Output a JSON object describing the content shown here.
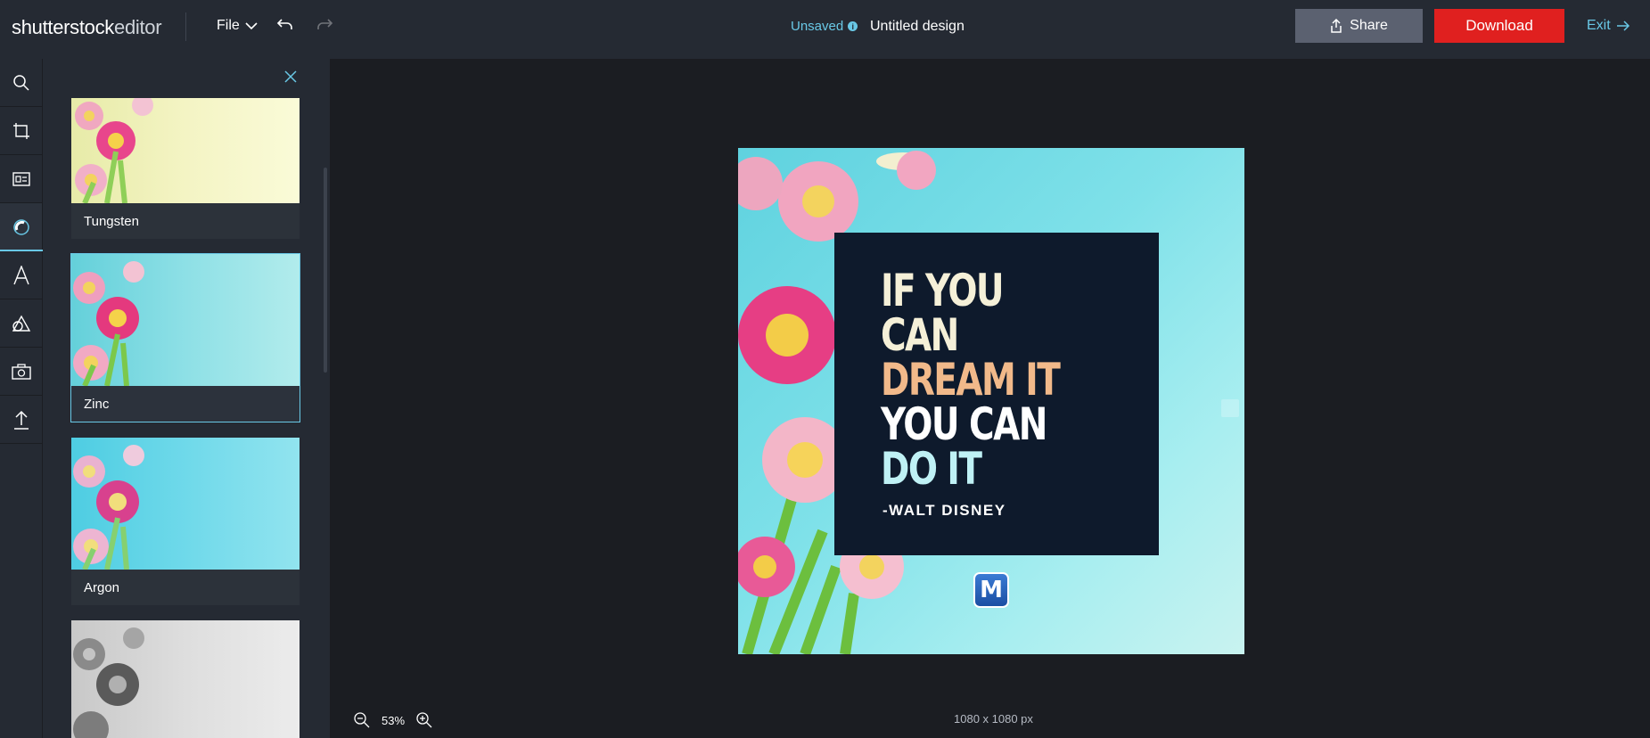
{
  "header": {
    "logo_main": "shutterstock",
    "logo_suffix": "editor",
    "file_menu": "File",
    "status": "Unsaved",
    "doc_title": "Untitled design",
    "share_label": "Share",
    "download_label": "Download",
    "exit_label": "Exit"
  },
  "rail": {
    "items": [
      "search-icon",
      "crop-icon",
      "layout-icon",
      "filter-icon",
      "text-icon",
      "shapes-icon",
      "elements-icon",
      "upload-icon"
    ],
    "active_index": 3
  },
  "filters": {
    "items": [
      {
        "label": "Tungsten",
        "tint": "#f4f0c8",
        "selected": false
      },
      {
        "label": "Zinc",
        "tint": "#86dde5",
        "selected": true
      },
      {
        "label": "Argon",
        "tint": "#6dd7e8",
        "selected": false
      },
      {
        "label": "",
        "tint": "#d8d8d8",
        "selected": false
      }
    ]
  },
  "design": {
    "quote_lines": [
      "IF YOU",
      "CAN",
      "DREAM IT",
      "YOU CAN",
      "DO IT"
    ],
    "author": "-WALT DISNEY",
    "badge": "M"
  },
  "footer": {
    "zoom": "53%",
    "dimensions": "1080 x 1080 px"
  },
  "colors": {
    "accent": "#69c8e6",
    "download": "#e0201f",
    "share": "#5b6170"
  }
}
